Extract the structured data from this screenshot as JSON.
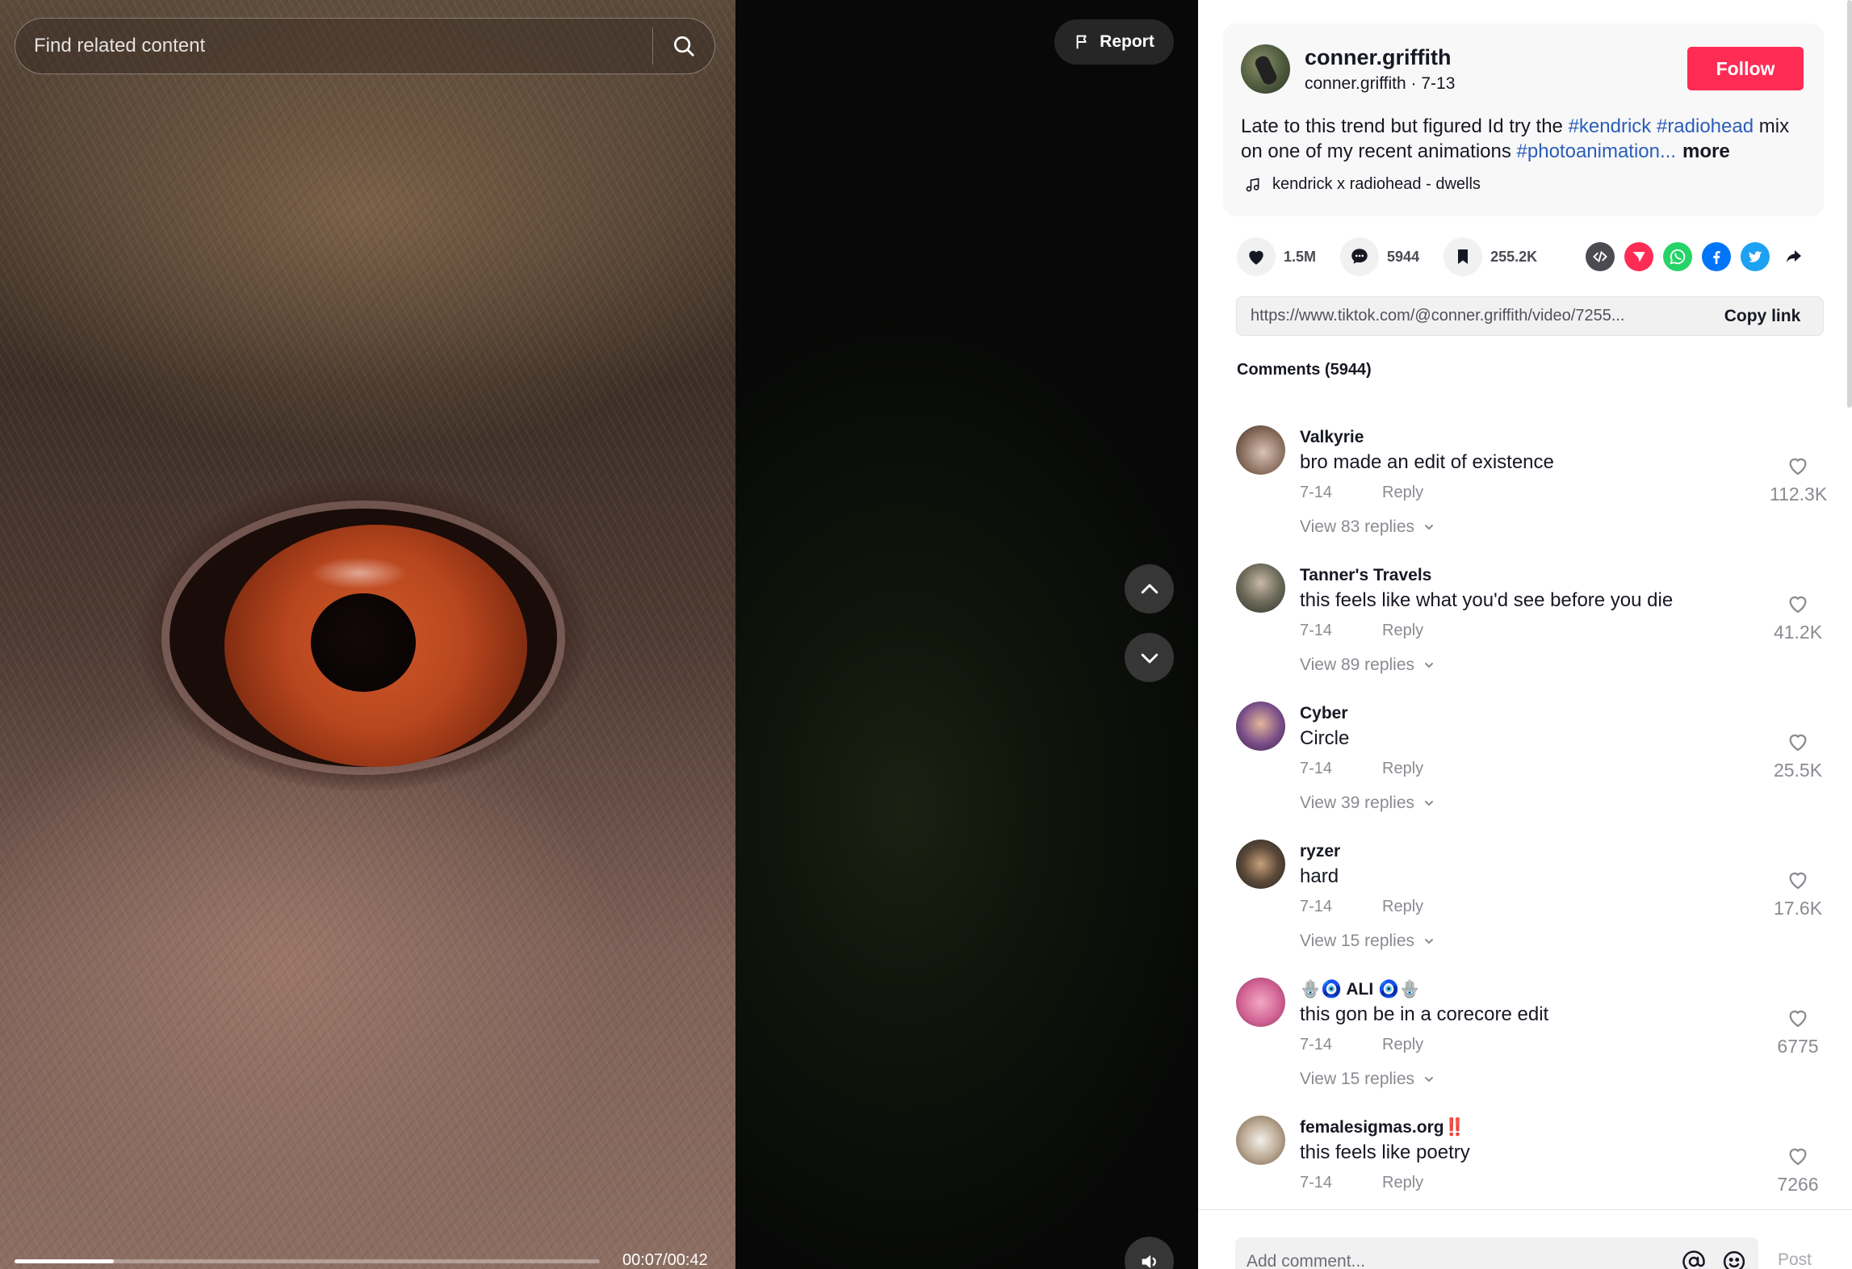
{
  "search": {
    "placeholder": "Find related content"
  },
  "report": {
    "label": "Report"
  },
  "player": {
    "time": "00:07/00:42",
    "progress_fraction": 0.17
  },
  "author": {
    "name": "conner.griffith",
    "handle_date": "conner.griffith · 7-13",
    "follow_label": "Follow"
  },
  "description": {
    "part1": "Late to this trend but figured Id try the ",
    "tag1": "#kendrick",
    "tag2": "#radiohead",
    "part2": " mix on one of my recent animations ",
    "tag3": "#photoanimation...",
    "more": "more"
  },
  "music": "kendrick x radiohead - dwells",
  "stats": {
    "likes": "1.5M",
    "comments": "5944",
    "saves": "255.2K"
  },
  "share": {
    "icons": [
      "embed-icon",
      "send-icon",
      "whatsapp-icon",
      "facebook-icon",
      "twitter-icon",
      "share-arrow-icon"
    ],
    "colors": {
      "embed": "#4b4c52",
      "send": "#fe2c55",
      "whatsapp": "#25d366",
      "facebook": "#0075fa",
      "twitter": "#1da1f2"
    }
  },
  "link": {
    "url": "https://www.tiktok.com/@conner.griffith/video/7255...",
    "copy_label": "Copy link"
  },
  "comments_title": "Comments (5944)",
  "comments": [
    {
      "user": "Valkyrie",
      "text": "bro made an edit of existence",
      "date": "7-14",
      "reply": "Reply",
      "view": "View 83 replies",
      "likes": "112.3K"
    },
    {
      "user": "Tanner's Travels",
      "text": "this feels like what you'd see before you die",
      "date": "7-14",
      "reply": "Reply",
      "view": "View 89 replies",
      "likes": "41.2K"
    },
    {
      "user": "Cyber",
      "text": "Circle",
      "date": "7-14",
      "reply": "Reply",
      "view": "View 39 replies",
      "likes": "25.5K"
    },
    {
      "user": "ryzer",
      "text": "hard",
      "date": "7-14",
      "reply": "Reply",
      "view": "View 15 replies",
      "likes": "17.6K"
    },
    {
      "user": "🪬🧿 ALI 🧿🪬",
      "text": "this gon be in a corecore edit",
      "date": "7-14",
      "reply": "Reply",
      "view": "View 15 replies",
      "likes": "6775"
    },
    {
      "user": "femalesigmas.org‼️",
      "text": "this feels like poetry",
      "date": "7-14",
      "reply": "Reply",
      "view": "",
      "likes": "7266"
    }
  ],
  "comment_bar": {
    "placeholder": "Add comment...",
    "post_label": "Post"
  },
  "colors": {
    "accent": "#fe2c55",
    "hashtag": "#2b5db9"
  }
}
